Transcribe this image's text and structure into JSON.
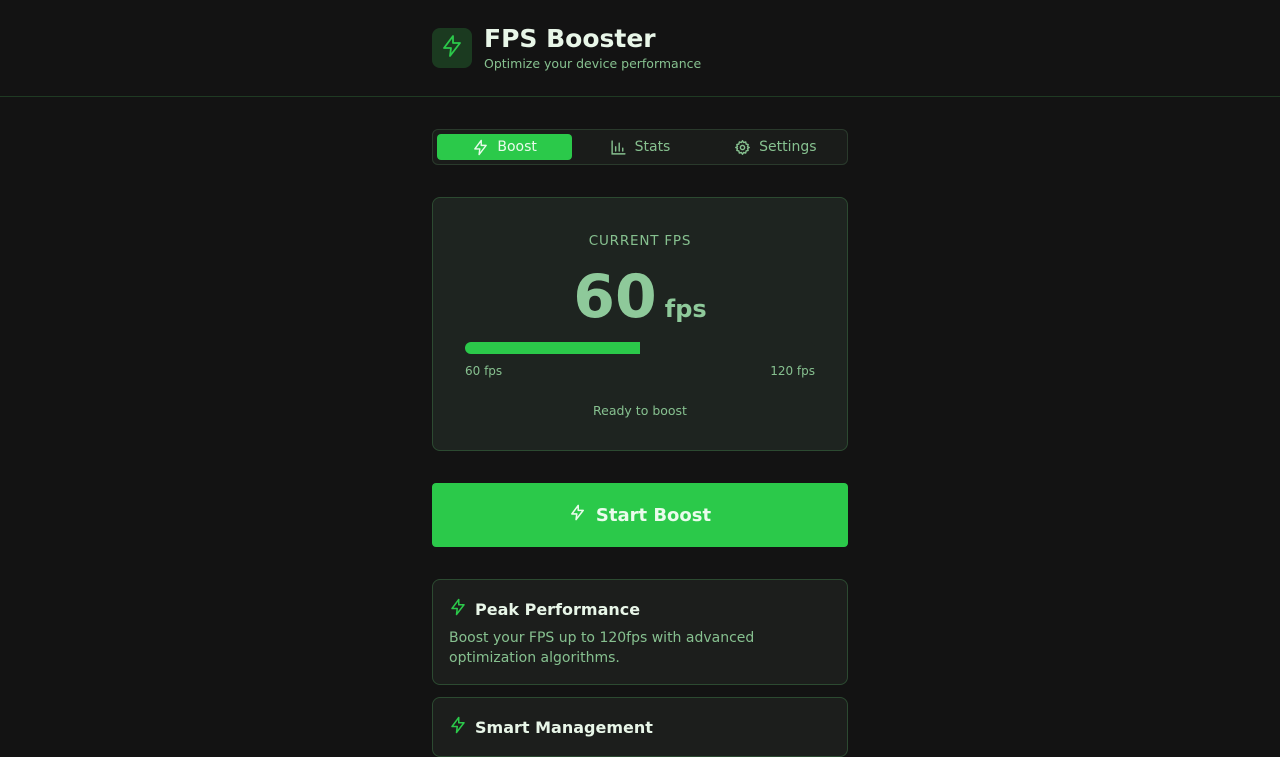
{
  "header": {
    "title": "FPS Booster",
    "subtitle": "Optimize your device performance",
    "logo_icon": "lightning-icon"
  },
  "tabs": [
    {
      "label": "Boost",
      "icon": "lightning-icon",
      "active": true
    },
    {
      "label": "Stats",
      "icon": "bar-chart-icon",
      "active": false
    },
    {
      "label": "Settings",
      "icon": "gear-icon",
      "active": false
    }
  ],
  "fps_card": {
    "caption": "CURRENT FPS",
    "value": "60",
    "unit": "fps",
    "progress_fraction": 0.5,
    "range_min": "60 fps",
    "range_max": "120 fps",
    "status": "Ready to boost"
  },
  "boost_button": {
    "label": "Start Boost",
    "icon": "lightning-icon"
  },
  "features": [
    {
      "title": "Peak Performance",
      "icon": "lightning-icon",
      "description": "Boost your FPS up to 120fps with advanced optimization algorithms."
    },
    {
      "title": "Smart Management",
      "icon": "lightning-icon",
      "description": ""
    }
  ],
  "colors": {
    "accent": "#2bc94a",
    "background": "#131313",
    "muted_text": "#86c08f"
  }
}
